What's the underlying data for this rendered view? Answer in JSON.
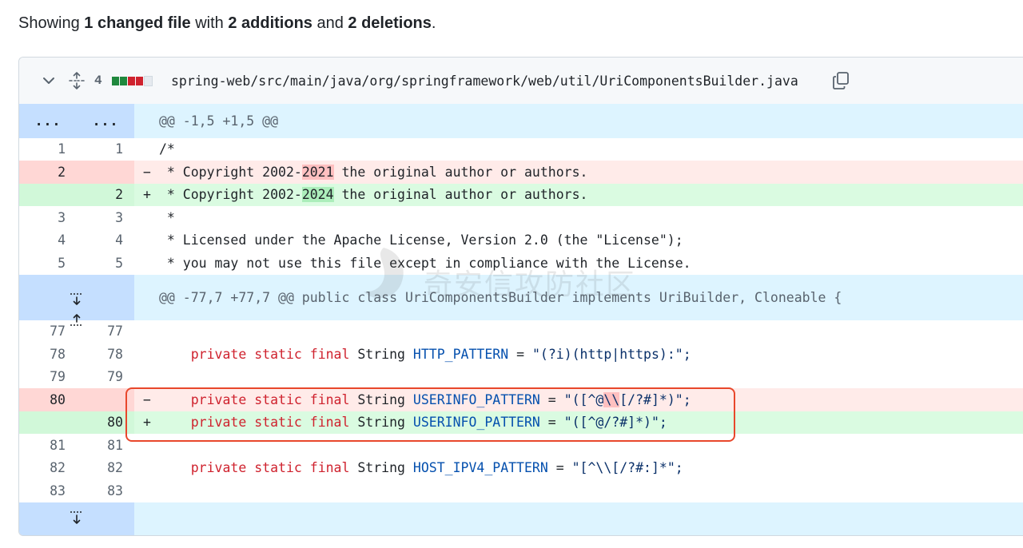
{
  "summary": {
    "prefix": "Showing ",
    "changed": "1 changed file",
    "mid": " with ",
    "additions": "2 additions",
    "and": " and ",
    "deletions": "2 deletions",
    "suffix": "."
  },
  "file": {
    "change_count": "4",
    "path": "spring-web/src/main/java/org/springframework/web/util/UriComponentsBuilder.java",
    "diffstat": [
      "add",
      "add",
      "del",
      "del",
      "neutral"
    ],
    "colors": {
      "add": "#1f883d",
      "del": "#cf222e",
      "neutral": "#e6eaef"
    }
  },
  "hunks": {
    "h1": {
      "left": "...",
      "right": "...",
      "text": "@@ -1,5 +1,5 @@"
    },
    "h2": {
      "text": "@@ -77,7 +77,7 @@ public class UriComponentsBuilder implements UriBuilder, Cloneable {"
    }
  },
  "lines": {
    "l1": {
      "o": "1",
      "n": "1",
      "m": "",
      "t": "/*"
    },
    "l2": {
      "o": "2",
      "n": "",
      "m": "−",
      "pre": " * Copyright 2002-",
      "hl": "2021",
      "post": " the original author or authors."
    },
    "l3": {
      "o": "",
      "n": "2",
      "m": "+",
      "pre": " * Copyright 2002-",
      "hl": "2024",
      "post": " the original author or authors."
    },
    "l4": {
      "o": "3",
      "n": "3",
      "m": "",
      "t": " *"
    },
    "l5": {
      "o": "4",
      "n": "4",
      "m": "",
      "t": " * Licensed under the Apache License, Version 2.0 (the \"License\");"
    },
    "l6": {
      "o": "5",
      "n": "5",
      "m": "",
      "t": " * you may not use this file except in compliance with the License."
    },
    "l7": {
      "o": "77",
      "n": "77",
      "m": "",
      "t": ""
    },
    "l8": {
      "o": "78",
      "n": "78",
      "m": "",
      "k": "private static final",
      "ty": "String",
      "v": "HTTP_PATTERN",
      "eq": " = ",
      "s": "\"(?i)(http|https):\";"
    },
    "l9": {
      "o": "79",
      "n": "79",
      "m": "",
      "t": ""
    },
    "l10": {
      "o": "80",
      "n": "",
      "m": "−",
      "k": "private static final",
      "ty": "String",
      "v": "USERINFO_PATTERN",
      "eq": " = ",
      "s1": "\"([^@",
      "hl": "\\\\",
      "s2": "[/?#]*)\";"
    },
    "l11": {
      "o": "",
      "n": "80",
      "m": "+",
      "k": "private static final",
      "ty": "String",
      "v": "USERINFO_PATTERN",
      "eq": " = ",
      "s": "\"([^@/?#]*)\";"
    },
    "l12": {
      "o": "81",
      "n": "81",
      "m": "",
      "t": ""
    },
    "l13": {
      "o": "82",
      "n": "82",
      "m": "",
      "k": "private static final",
      "ty": "String",
      "v": "HOST_IPV4_PATTERN",
      "eq": " = ",
      "s": "\"[^\\\\[/?#:]*\";"
    },
    "l14": {
      "o": "83",
      "n": "83",
      "m": "",
      "t": ""
    }
  },
  "watermark": {
    "text": "奇安信攻防社区"
  }
}
